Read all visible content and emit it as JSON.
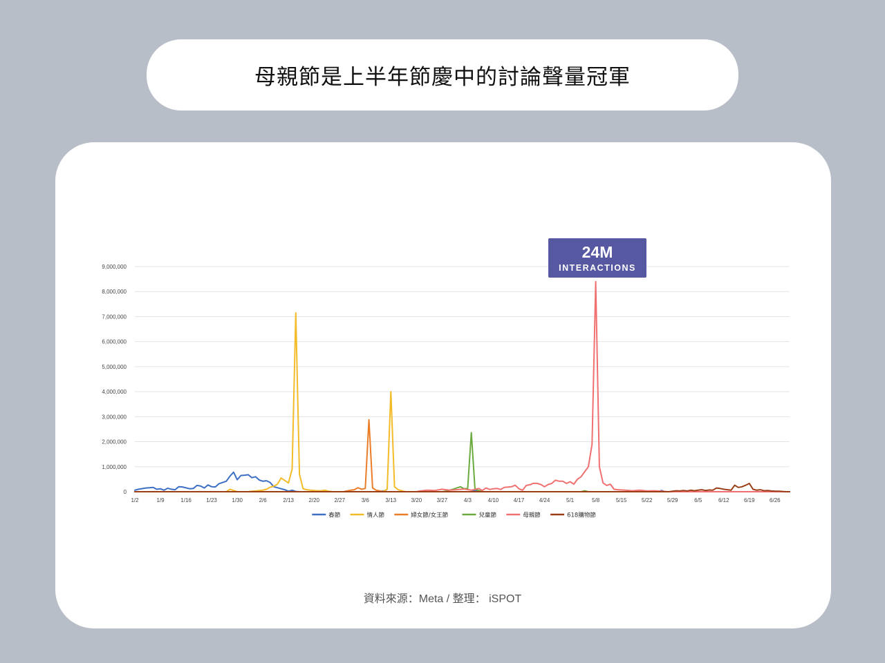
{
  "title": "母親節是上半年節慶中的討論聲量冠軍",
  "source": "資料來源：Meta / 整理： iSPOT",
  "callout": {
    "value": "24M",
    "label": "INTERACTIONS",
    "color": "#5658a2"
  },
  "chart_data": {
    "type": "line",
    "title": "",
    "xlabel": "",
    "ylabel": "",
    "ylim": [
      0,
      9000000
    ],
    "yticks": [
      0,
      1000000,
      2000000,
      3000000,
      4000000,
      5000000,
      6000000,
      7000000,
      8000000,
      9000000
    ],
    "ytick_labels": [
      "0",
      "1,000,000",
      "2,000,000",
      "3,000,000",
      "4,000,000",
      "5,000,000",
      "6,000,000",
      "7,000,000",
      "8,000,000",
      "9,000,000"
    ],
    "x_start": "1/2",
    "x_end": "6/30",
    "xtick_labels": [
      "1/2",
      "1/9",
      "1/16",
      "1/23",
      "1/30",
      "2/6",
      "2/13",
      "2/20",
      "2/27",
      "3/6",
      "3/13",
      "3/20",
      "3/27",
      "4/3",
      "4/10",
      "4/17",
      "4/24",
      "5/1",
      "5/8",
      "5/15",
      "5/22",
      "5/29",
      "6/5",
      "6/12",
      "6/19",
      "6/26"
    ],
    "grid": true,
    "legend_position": "bottom",
    "series": [
      {
        "name": "春節",
        "color": "#3b6fc4",
        "points": [
          [
            "1/2",
            60000
          ],
          [
            "1/3",
            100000
          ],
          [
            "1/5",
            150000
          ],
          [
            "1/6",
            160000
          ],
          [
            "1/7",
            170000
          ],
          [
            "1/8",
            100000
          ],
          [
            "1/9",
            120000
          ],
          [
            "1/10",
            60000
          ],
          [
            "1/11",
            140000
          ],
          [
            "1/12",
            100000
          ],
          [
            "1/13",
            80000
          ],
          [
            "1/14",
            200000
          ],
          [
            "1/15",
            190000
          ],
          [
            "1/17",
            120000
          ],
          [
            "1/18",
            130000
          ],
          [
            "1/19",
            250000
          ],
          [
            "1/20",
            230000
          ],
          [
            "1/21",
            150000
          ],
          [
            "1/22",
            270000
          ],
          [
            "1/23",
            200000
          ],
          [
            "1/24",
            190000
          ],
          [
            "1/25",
            320000
          ],
          [
            "1/26",
            370000
          ],
          [
            "1/27",
            420000
          ],
          [
            "1/28",
            620000
          ],
          [
            "1/29",
            780000
          ],
          [
            "1/30",
            480000
          ],
          [
            "1/31",
            650000
          ],
          [
            "2/1",
            660000
          ],
          [
            "2/2",
            680000
          ],
          [
            "2/3",
            560000
          ],
          [
            "2/4",
            600000
          ],
          [
            "2/5",
            470000
          ],
          [
            "2/6",
            420000
          ],
          [
            "2/7",
            440000
          ],
          [
            "2/8",
            370000
          ],
          [
            "2/9",
            200000
          ],
          [
            "2/10",
            160000
          ],
          [
            "2/11",
            120000
          ],
          [
            "2/12",
            80000
          ],
          [
            "2/13",
            20000
          ],
          [
            "2/14",
            60000
          ],
          [
            "2/15",
            10000
          ],
          [
            "2/16",
            0
          ],
          [
            "3/10",
            0
          ],
          [
            "3/11",
            40000
          ],
          [
            "3/12",
            0
          ],
          [
            "4/4",
            0
          ],
          [
            "4/5",
            40000
          ],
          [
            "4/6",
            0
          ],
          [
            "5/25",
            0
          ],
          [
            "5/26",
            50000
          ],
          [
            "5/27",
            0
          ],
          [
            "6/30",
            0
          ]
        ]
      },
      {
        "name": "情人節",
        "color": "#f4bb28",
        "points": [
          [
            "1/2",
            0
          ],
          [
            "1/27",
            0
          ],
          [
            "1/28",
            100000
          ],
          [
            "1/29",
            50000
          ],
          [
            "1/30",
            0
          ],
          [
            "2/2",
            0
          ],
          [
            "2/3",
            20000
          ],
          [
            "2/4",
            30000
          ],
          [
            "2/5",
            50000
          ],
          [
            "2/6",
            60000
          ],
          [
            "2/7",
            100000
          ],
          [
            "2/8",
            180000
          ],
          [
            "2/9",
            220000
          ],
          [
            "2/10",
            300000
          ],
          [
            "2/11",
            550000
          ],
          [
            "2/12",
            450000
          ],
          [
            "2/13",
            350000
          ],
          [
            "2/14",
            900000
          ],
          [
            "2/15",
            7150000
          ],
          [
            "2/16",
            700000
          ],
          [
            "2/17",
            120000
          ],
          [
            "2/18",
            80000
          ],
          [
            "2/19",
            60000
          ],
          [
            "2/20",
            50000
          ],
          [
            "2/21",
            40000
          ],
          [
            "2/22",
            40000
          ],
          [
            "2/23",
            60000
          ],
          [
            "2/24",
            20000
          ],
          [
            "2/25",
            0
          ],
          [
            "3/10",
            0
          ],
          [
            "3/11",
            20000
          ],
          [
            "3/12",
            100000
          ],
          [
            "3/13",
            4000000
          ],
          [
            "3/14",
            200000
          ],
          [
            "3/15",
            80000
          ],
          [
            "3/16",
            40000
          ],
          [
            "3/17",
            0
          ],
          [
            "6/30",
            0
          ]
        ]
      },
      {
        "name": "婦女節/女王節",
        "color": "#eb7c26",
        "points": [
          [
            "1/2",
            0
          ],
          [
            "2/28",
            0
          ],
          [
            "3/1",
            30000
          ],
          [
            "3/2",
            60000
          ],
          [
            "3/3",
            80000
          ],
          [
            "3/4",
            160000
          ],
          [
            "3/5",
            100000
          ],
          [
            "3/6",
            130000
          ],
          [
            "3/7",
            2880000
          ],
          [
            "3/8",
            150000
          ],
          [
            "3/9",
            60000
          ],
          [
            "3/10",
            30000
          ],
          [
            "3/11",
            0
          ],
          [
            "6/30",
            0
          ]
        ]
      },
      {
        "name": "兒童節",
        "color": "#6aaa3e",
        "points": [
          [
            "1/2",
            0
          ],
          [
            "3/27",
            0
          ],
          [
            "3/28",
            20000
          ],
          [
            "3/29",
            60000
          ],
          [
            "3/30",
            100000
          ],
          [
            "3/31",
            150000
          ],
          [
            "4/1",
            200000
          ],
          [
            "4/2",
            120000
          ],
          [
            "4/3",
            130000
          ],
          [
            "4/4",
            2360000
          ],
          [
            "4/5",
            100000
          ],
          [
            "4/6",
            50000
          ],
          [
            "4/7",
            0
          ],
          [
            "5/4",
            0
          ],
          [
            "5/5",
            40000
          ],
          [
            "5/6",
            0
          ],
          [
            "6/30",
            0
          ]
        ]
      },
      {
        "name": "母親節",
        "color": "#f07070",
        "points": [
          [
            "1/2",
            0
          ],
          [
            "3/20",
            0
          ],
          [
            "3/21",
            30000
          ],
          [
            "3/23",
            60000
          ],
          [
            "3/25",
            50000
          ],
          [
            "3/27",
            100000
          ],
          [
            "3/29",
            60000
          ],
          [
            "3/31",
            80000
          ],
          [
            "4/2",
            110000
          ],
          [
            "4/4",
            60000
          ],
          [
            "4/6",
            130000
          ],
          [
            "4/7",
            50000
          ],
          [
            "4/8",
            150000
          ],
          [
            "4/9",
            90000
          ],
          [
            "4/10",
            120000
          ],
          [
            "4/11",
            130000
          ],
          [
            "4/12",
            90000
          ],
          [
            "4/13",
            170000
          ],
          [
            "4/15",
            200000
          ],
          [
            "4/16",
            260000
          ],
          [
            "4/17",
            120000
          ],
          [
            "4/18",
            60000
          ],
          [
            "4/19",
            250000
          ],
          [
            "4/20",
            280000
          ],
          [
            "4/21",
            340000
          ],
          [
            "4/22",
            330000
          ],
          [
            "4/23",
            290000
          ],
          [
            "4/24",
            200000
          ],
          [
            "4/25",
            290000
          ],
          [
            "4/26",
            330000
          ],
          [
            "4/27",
            460000
          ],
          [
            "4/28",
            420000
          ],
          [
            "4/29",
            420000
          ],
          [
            "4/30",
            330000
          ],
          [
            "5/1",
            400000
          ],
          [
            "5/2",
            300000
          ],
          [
            "5/3",
            500000
          ],
          [
            "5/4",
            600000
          ],
          [
            "5/5",
            800000
          ],
          [
            "5/6",
            1000000
          ],
          [
            "5/7",
            1900000
          ],
          [
            "5/8",
            8400000
          ],
          [
            "5/9",
            1000000
          ],
          [
            "5/10",
            350000
          ],
          [
            "5/11",
            250000
          ],
          [
            "5/12",
            300000
          ],
          [
            "5/13",
            100000
          ],
          [
            "5/14",
            80000
          ],
          [
            "5/16",
            60000
          ],
          [
            "5/18",
            40000
          ],
          [
            "5/20",
            60000
          ],
          [
            "5/22",
            30000
          ],
          [
            "5/24",
            40000
          ],
          [
            "5/26",
            20000
          ],
          [
            "5/28",
            0
          ],
          [
            "6/30",
            0
          ]
        ]
      },
      {
        "name": "618購物節",
        "color": "#9a3d16",
        "points": [
          [
            "1/2",
            0
          ],
          [
            "5/28",
            0
          ],
          [
            "5/29",
            20000
          ],
          [
            "5/30",
            40000
          ],
          [
            "5/31",
            30000
          ],
          [
            "6/1",
            50000
          ],
          [
            "6/2",
            30000
          ],
          [
            "6/3",
            60000
          ],
          [
            "6/4",
            40000
          ],
          [
            "6/5",
            60000
          ],
          [
            "6/6",
            80000
          ],
          [
            "6/7",
            50000
          ],
          [
            "6/8",
            70000
          ],
          [
            "6/9",
            60000
          ],
          [
            "6/10",
            150000
          ],
          [
            "6/11",
            130000
          ],
          [
            "6/12",
            100000
          ],
          [
            "6/13",
            80000
          ],
          [
            "6/14",
            60000
          ],
          [
            "6/15",
            260000
          ],
          [
            "6/16",
            170000
          ],
          [
            "6/17",
            200000
          ],
          [
            "6/18",
            260000
          ],
          [
            "6/19",
            330000
          ],
          [
            "6/20",
            100000
          ],
          [
            "6/21",
            60000
          ],
          [
            "6/22",
            80000
          ],
          [
            "6/23",
            40000
          ],
          [
            "6/24",
            50000
          ],
          [
            "6/25",
            30000
          ],
          [
            "6/26",
            20000
          ],
          [
            "6/27",
            20000
          ],
          [
            "6/28",
            10000
          ],
          [
            "6/29",
            0
          ],
          [
            "6/30",
            0
          ]
        ]
      }
    ]
  }
}
